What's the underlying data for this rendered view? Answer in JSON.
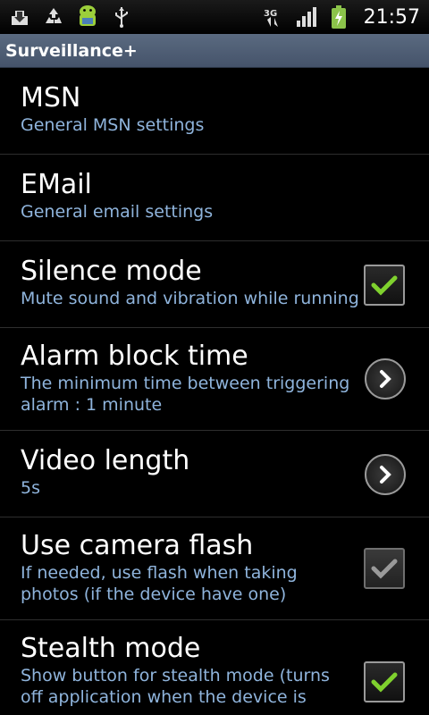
{
  "statusbar": {
    "time": "21:57",
    "left_icons": [
      "download-icon",
      "recycle-icon",
      "android-icon",
      "usb-icon"
    ],
    "right_icons": [
      "3g-icon",
      "signal-icon",
      "battery-charging-icon"
    ]
  },
  "app": {
    "title": "Surveillance+"
  },
  "settings": [
    {
      "title": "MSN",
      "summary": "General MSN settings",
      "widget": "none"
    },
    {
      "title": "EMail",
      "summary": "General email settings",
      "widget": "none"
    },
    {
      "title": "Silence mode",
      "summary": "Mute sound and vibration while running",
      "widget": "checkbox",
      "checked": true
    },
    {
      "title": "Alarm block time",
      "summary_line1": "The minimum time between triggering",
      "summary_line2": "alarm : 1 minute",
      "widget": "chevron"
    },
    {
      "title": "Video length",
      "summary": "5s",
      "widget": "chevron"
    },
    {
      "title": "Use camera flash",
      "summary_line1": "If needed, use flash when taking",
      "summary_line2": "photos (if the device have one)",
      "widget": "checkbox",
      "checked": true,
      "disabled": true
    },
    {
      "title": "Stealth mode",
      "summary_line1": "Show button for stealth mode (turns",
      "summary_line2": "off application when the device is",
      "widget": "checkbox",
      "checked": true
    }
  ],
  "colors": {
    "summary": "#8fb4dc",
    "check": "#7fd12e",
    "titlebar": "#4f5d73"
  }
}
